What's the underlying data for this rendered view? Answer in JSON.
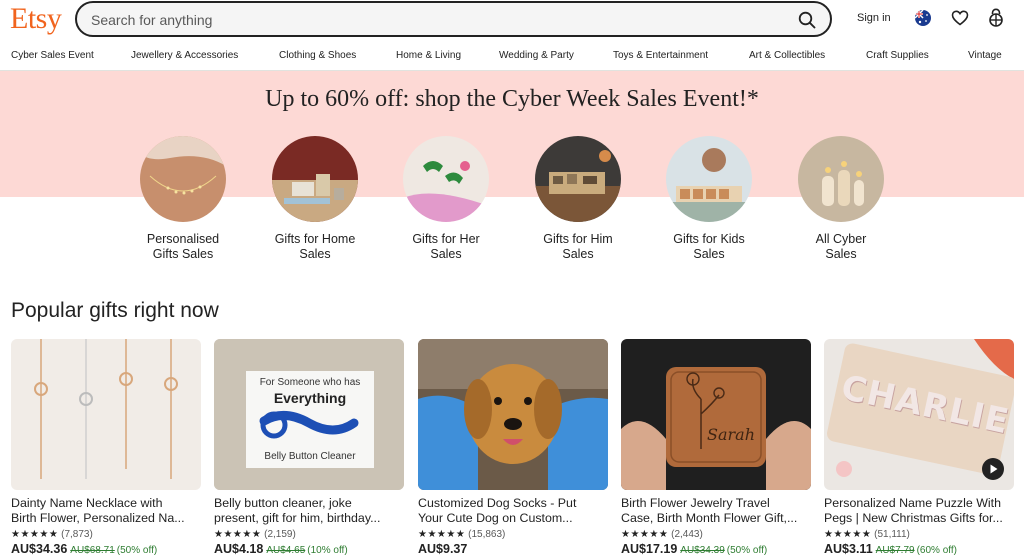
{
  "header": {
    "logo": "Etsy",
    "search_placeholder": "Search for anything",
    "signin": "Sign in",
    "logo_color": "#f1641e"
  },
  "nav": [
    "Cyber Sales Event",
    "Jewellery & Accessories",
    "Clothing & Shoes",
    "Home & Living",
    "Wedding & Party",
    "Toys & Entertainment",
    "Art & Collectibles",
    "Craft Supplies",
    "Vintage"
  ],
  "banner": {
    "title": "Up to 60% off: shop the Cyber Week Sales Event!*",
    "color": "#fdd9d5"
  },
  "categories": [
    {
      "line1": "Personalised",
      "line2": "Gifts Sales"
    },
    {
      "line1": "Gifts for Home",
      "line2": "Sales"
    },
    {
      "line1": "Gifts for Her",
      "line2": "Sales"
    },
    {
      "line1": "Gifts for Him",
      "line2": "Sales"
    },
    {
      "line1": "Gifts for Kids",
      "line2": "Sales"
    },
    {
      "line1": "All Cyber",
      "line2": "Sales"
    }
  ],
  "section_title": "Popular gifts right now",
  "products": [
    {
      "line1": "Dainty Name Necklace with",
      "line2": "Birth Flower, Personalized Na...",
      "stars": "★★★★★",
      "reviews": "(7,873)",
      "price": "AU$34.36",
      "was": "AU$68.71",
      "off": "(50% off)"
    },
    {
      "line1": "Belly button cleaner, joke",
      "line2": "present, gift for him, birthday...",
      "stars": "★★★★★",
      "reviews": "(2,159)",
      "price": "AU$4.18",
      "was": "AU$4.65",
      "off": "(10% off)",
      "img_line1": "For Someone who has",
      "img_line2": "Everything",
      "img_line3": "Belly Button Cleaner"
    },
    {
      "line1": "Customized Dog Socks - Put",
      "line2": "Your Cute Dog on Custom...",
      "stars": "★★★★★",
      "reviews": "(15,863)",
      "price": "AU$9.37",
      "was": "",
      "off": ""
    },
    {
      "line1": "Birth Flower Jewelry Travel",
      "line2": "Case, Birth Month Flower Gift,...",
      "stars": "★★★★★",
      "reviews": "(2,443)",
      "price": "AU$17.19",
      "was": "AU$34.39",
      "off": "(50% off)",
      "img_text": "Sarah"
    },
    {
      "line1": "Personalized Name Puzzle With",
      "line2": "Pegs | New Christmas Gifts for...",
      "stars": "★★★★★",
      "reviews": "(51,111)",
      "price": "AU$3.11",
      "was": "AU$7.79",
      "off": "(60% off)",
      "img_text": "CHARLIE"
    }
  ]
}
